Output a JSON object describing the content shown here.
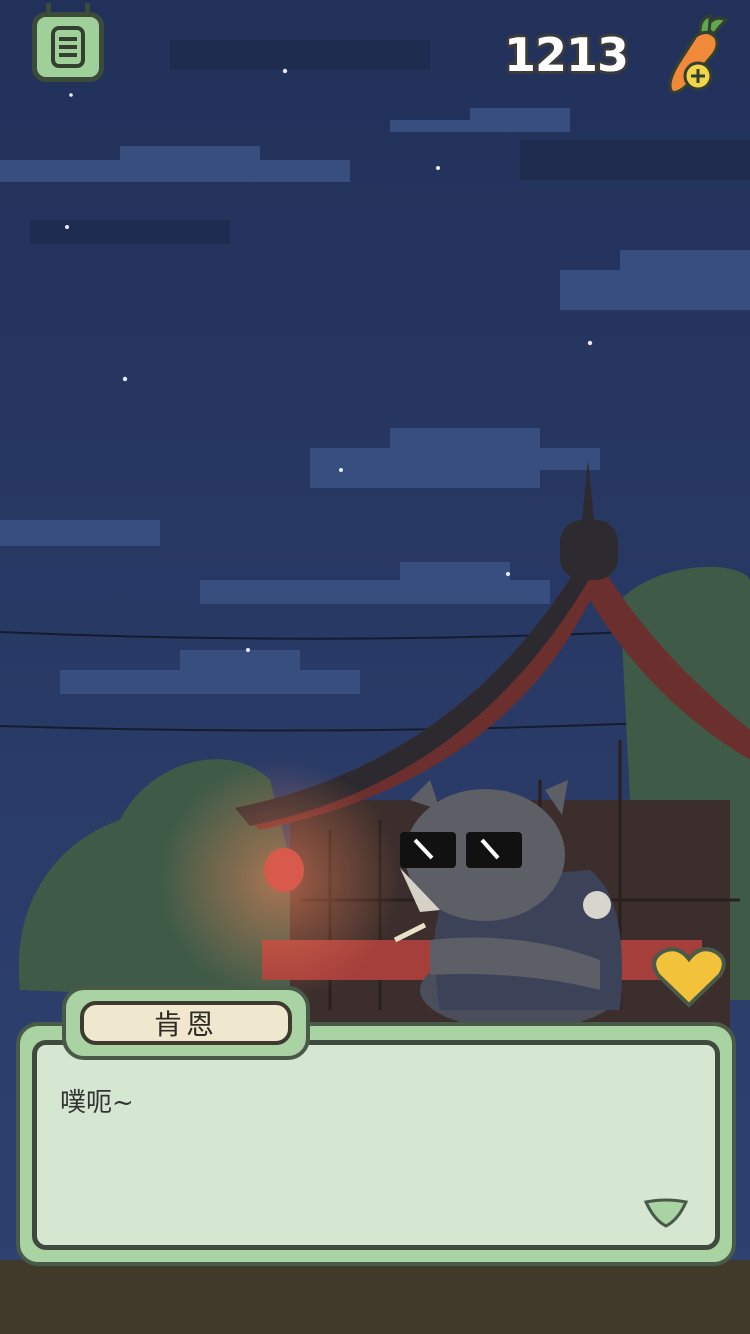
{
  "hud": {
    "carrot_count": "1213"
  },
  "dialog": {
    "speaker": "肯恩",
    "text": "噗呃~"
  },
  "colors": {
    "sky": "#27365f",
    "dialog_green": "#a9d3a3",
    "heart": "#f2c33a"
  }
}
